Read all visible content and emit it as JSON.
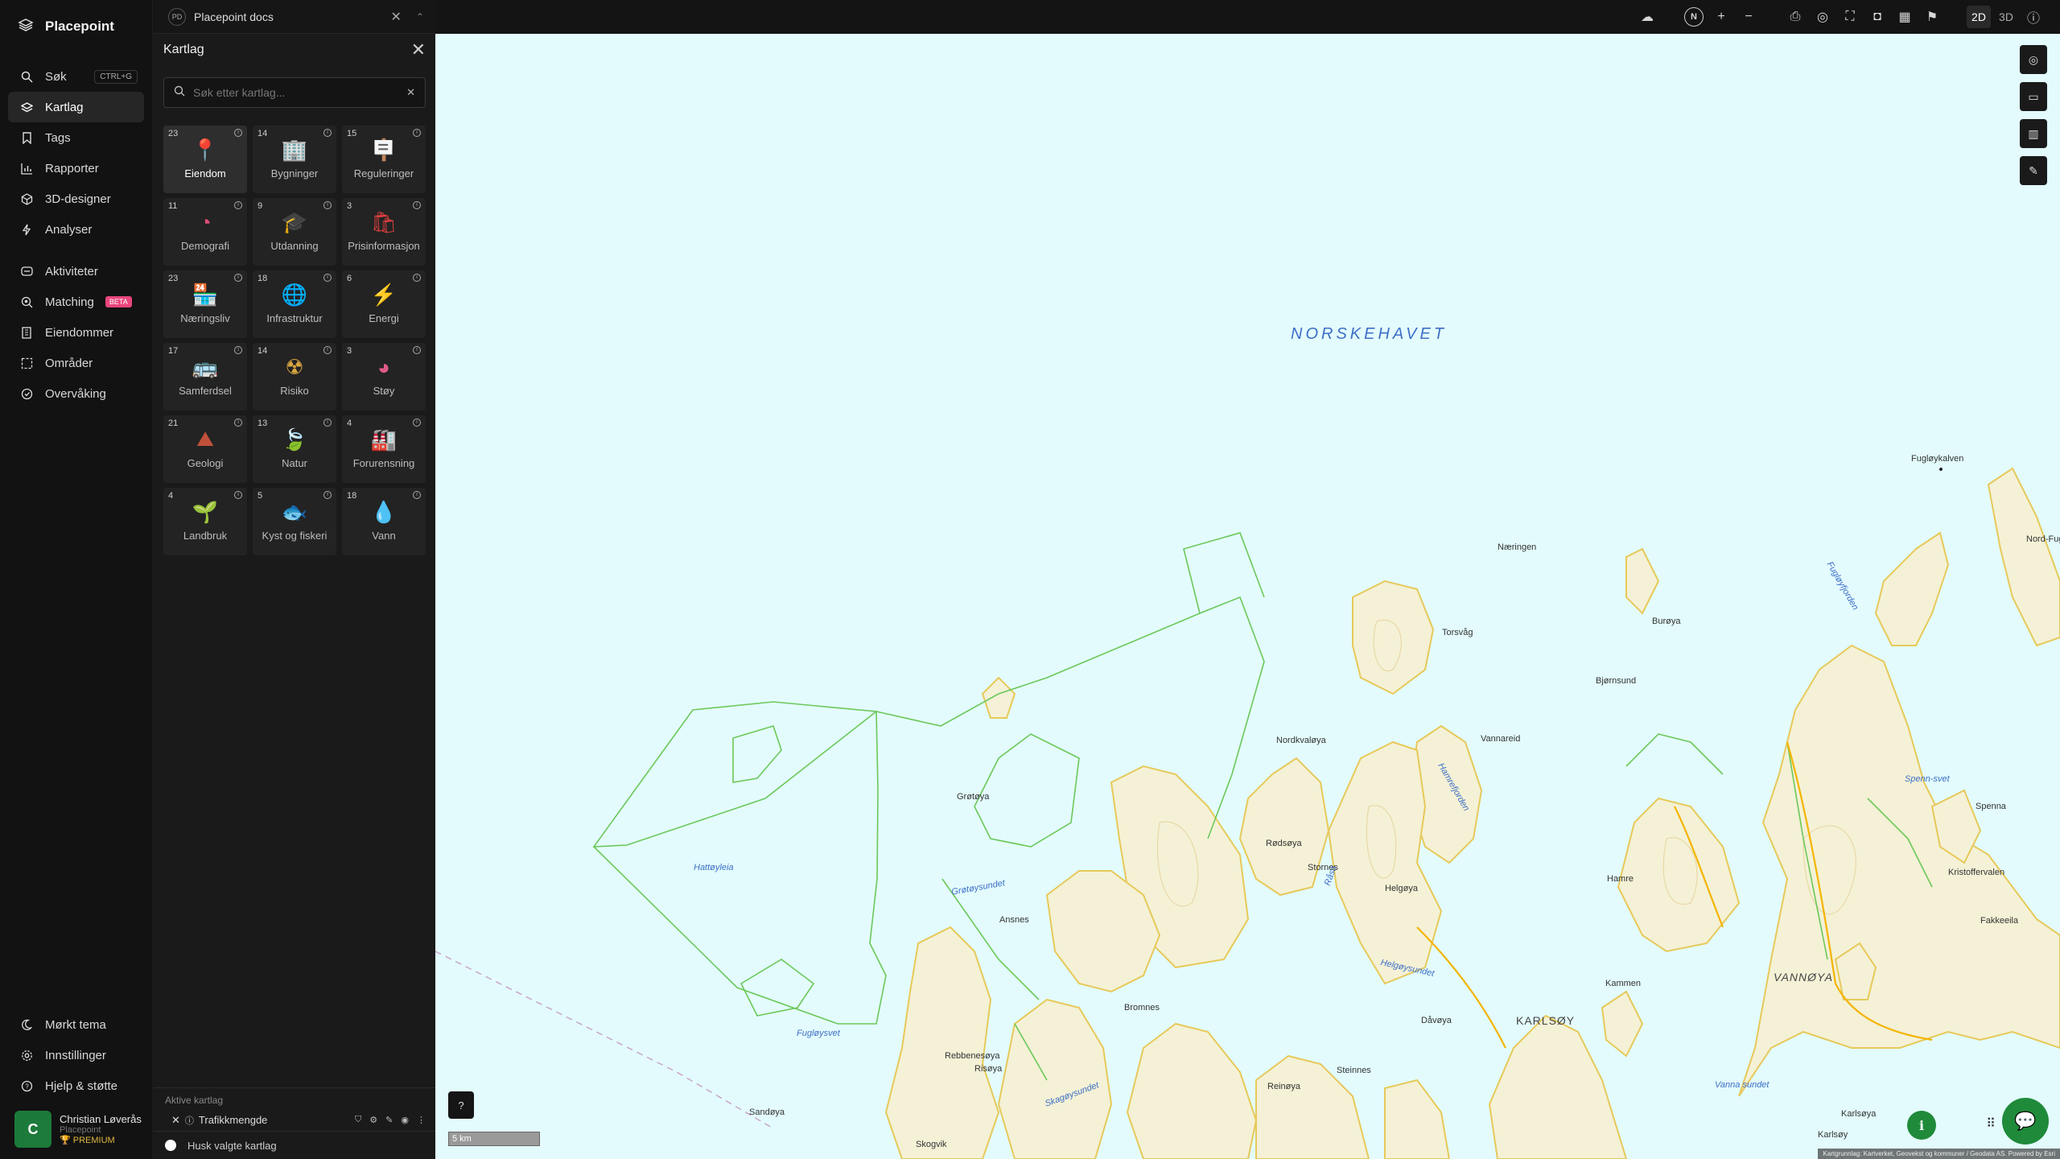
{
  "brand": {
    "name": "Placepoint"
  },
  "nav": {
    "items": [
      {
        "label": "Søk",
        "icon": "search-icon",
        "shortcut": "CTRL+G"
      },
      {
        "label": "Kartlag",
        "icon": "layers-icon",
        "active": true
      },
      {
        "label": "Tags",
        "icon": "bookmark-icon"
      },
      {
        "label": "Rapporter",
        "icon": "chart-icon"
      },
      {
        "label": "3D-designer",
        "icon": "cube-icon"
      },
      {
        "label": "Analyser",
        "icon": "bolt-icon"
      }
    ],
    "items2": [
      {
        "label": "Aktiviteter",
        "icon": "activity-icon"
      },
      {
        "label": "Matching",
        "icon": "match-icon",
        "badge": "BETA"
      },
      {
        "label": "Eiendommer",
        "icon": "building-icon"
      },
      {
        "label": "Områder",
        "icon": "area-icon"
      },
      {
        "label": "Overvåking",
        "icon": "monitor-icon"
      }
    ],
    "bottom": [
      {
        "label": "Mørkt tema",
        "icon": "moon-icon"
      },
      {
        "label": "Innstillinger",
        "icon": "gear-icon"
      },
      {
        "label": "Hjelp & støtte",
        "icon": "help-icon"
      }
    ],
    "user": {
      "initial": "C",
      "name": "Christian Løverås",
      "org": "Placepoint",
      "plan": "PREMIUM"
    }
  },
  "docbar": {
    "badge": "PD",
    "title": "Placepoint docs"
  },
  "panel": {
    "title": "Kartlag",
    "search_placeholder": "Søk etter kartlag...",
    "categories": [
      {
        "count": "23",
        "label": "Eiendom",
        "icon": "pin-icon",
        "color": "#e23b3b",
        "active": true
      },
      {
        "count": "14",
        "label": "Bygninger",
        "icon": "building-icon",
        "color": "#7aa2d6"
      },
      {
        "count": "15",
        "label": "Reguleringer",
        "icon": "signpost-icon",
        "color": "#e8a33a"
      },
      {
        "count": "11",
        "label": "Demografi",
        "icon": "people-icon",
        "color": "#e04f7a"
      },
      {
        "count": "9",
        "label": "Utdanning",
        "icon": "graduation-icon",
        "color": "#3a5fc8"
      },
      {
        "count": "3",
        "label": "Prisinformasjon",
        "icon": "price-bag-icon",
        "color": "#e04040"
      },
      {
        "count": "23",
        "label": "Næringsliv",
        "icon": "shop-icon",
        "color": "#d94a4a"
      },
      {
        "count": "18",
        "label": "Infrastruktur",
        "icon": "globe-icon",
        "color": "#6b7fe0"
      },
      {
        "count": "6",
        "label": "Energi",
        "icon": "lightning-icon",
        "color": "#f5c518"
      },
      {
        "count": "17",
        "label": "Samferdsel",
        "icon": "bus-icon",
        "color": "#c9a23a"
      },
      {
        "count": "14",
        "label": "Risiko",
        "icon": "hazard-icon",
        "color": "#d9a640"
      },
      {
        "count": "3",
        "label": "Støy",
        "icon": "noise-gauge-icon",
        "color": "#e05a8a"
      },
      {
        "count": "21",
        "label": "Geologi",
        "icon": "terrain-icon",
        "color": "#c0503a"
      },
      {
        "count": "13",
        "label": "Natur",
        "icon": "leaf-icon",
        "color": "#3bb85a"
      },
      {
        "count": "4",
        "label": "Forurensning",
        "icon": "factory-icon",
        "color": "#6fa0d8"
      },
      {
        "count": "4",
        "label": "Landbruk",
        "icon": "sprout-icon",
        "color": "#3bb84a"
      },
      {
        "count": "5",
        "label": "Kyst og fiskeri",
        "icon": "fish-icon",
        "color": "#f0a030"
      },
      {
        "count": "18",
        "label": "Vann",
        "icon": "water-drop-icon",
        "color": "#4aa8e8"
      }
    ],
    "active_layers_title": "Aktive kartlag",
    "active_layer": "Trafikkmengde",
    "remember_label": "Husk valgte kartlag"
  },
  "topbar": {
    "dim_2d": "2D",
    "dim_3d": "3D",
    "compass": "N"
  },
  "map": {
    "sea_label": "NORSKEHAVET",
    "scale_label": "5 km",
    "attribution": "Kartgrunnlag: Kartverket, Geovekst og kommuner / Geodata AS. Powered by Esri",
    "labels": {
      "l1": "Fugløykalven",
      "l2": "Nord-Fug",
      "l3": "Fugløyfjorden",
      "l4": "Næringen",
      "l5": "Torsvåg",
      "l6": "Burøya",
      "l7": "Bjørnsund",
      "l8": "Vannareid",
      "l9": "Nordkvaløya",
      "l10": "Grøtøya",
      "l11": "Hattøyleia",
      "l12": "Grøtøysundet",
      "l13": "Ansnes",
      "l14": "Helgøya",
      "l15": "Helgøysundet",
      "l16": "KARLSØY",
      "l17": "VANNØYA",
      "l18": "Kristoffervalen",
      "l19": "Fakkeeila",
      "l20": "Dåvøya",
      "l21": "Kammen",
      "l22": "Reinøya",
      "l23": "Sandøya",
      "l24": "Fugløysvet",
      "l25": "Vanna sundet",
      "l26": "Karlsøya",
      "l27": "Karlsøy",
      "l28": "Stornes",
      "l29": "Spenna",
      "l30": "Spenn-svet",
      "l31": "Skagøysundet",
      "l32": "Steinnes",
      "l33": "Bromnes",
      "l34": "Skogvik",
      "l35": "Risøya",
      "l36": "Hamre",
      "l37": "Rødsøya",
      "l38": "Rebbenesøya",
      "l39": "Hamrefjorden",
      "l40": "Råsa"
    }
  }
}
